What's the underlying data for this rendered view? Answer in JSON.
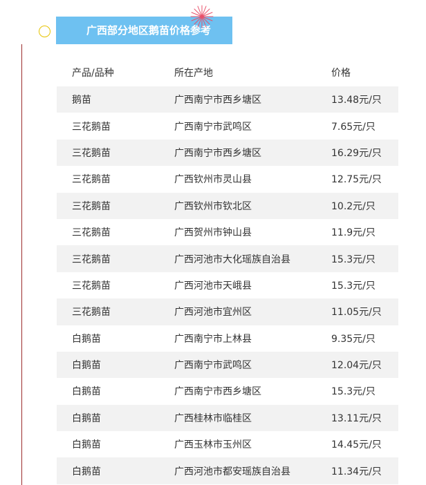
{
  "title": "广西部分地区鹅苗价格参考",
  "colors": {
    "title_bg": "#6ec1f1",
    "row_stripe": "#f2f2f2",
    "accent_line": "#9b2b2b",
    "circle": "#e6c300"
  },
  "table": {
    "headers": [
      "产品/品种",
      "所在产地",
      "价格"
    ],
    "rows": [
      [
        "鹅苗",
        "广西南宁市西乡塘区",
        "13.48元/只"
      ],
      [
        "三花鹅苗",
        "广西南宁市武鸣区",
        "7.65元/只"
      ],
      [
        "三花鹅苗",
        "广西南宁市西乡塘区",
        "16.29元/只"
      ],
      [
        "三花鹅苗",
        "广西钦州市灵山县",
        "12.75元/只"
      ],
      [
        "三花鹅苗",
        "广西钦州市钦北区",
        "10.2元/只"
      ],
      [
        "三花鹅苗",
        "广西贺州市钟山县",
        "11.9元/只"
      ],
      [
        "三花鹅苗",
        "广西河池市大化瑶族自治县",
        "15.3元/只"
      ],
      [
        "三花鹅苗",
        "广西河池市天峨县",
        "15.3元/只"
      ],
      [
        "三花鹅苗",
        "广西河池市宜州区",
        "11.05元/只"
      ],
      [
        "白鹅苗",
        "广西南宁市上林县",
        "9.35元/只"
      ],
      [
        "白鹅苗",
        "广西南宁市武鸣区",
        "12.04元/只"
      ],
      [
        "白鹅苗",
        "广西南宁市西乡塘区",
        "15.3元/只"
      ],
      [
        "白鹅苗",
        "广西桂林市临桂区",
        "13.11元/只"
      ],
      [
        "白鹅苗",
        "广西玉林市玉州区",
        "14.45元/只"
      ],
      [
        "白鹅苗",
        "广西河池市都安瑶族自治县",
        "11.34元/只"
      ]
    ]
  }
}
